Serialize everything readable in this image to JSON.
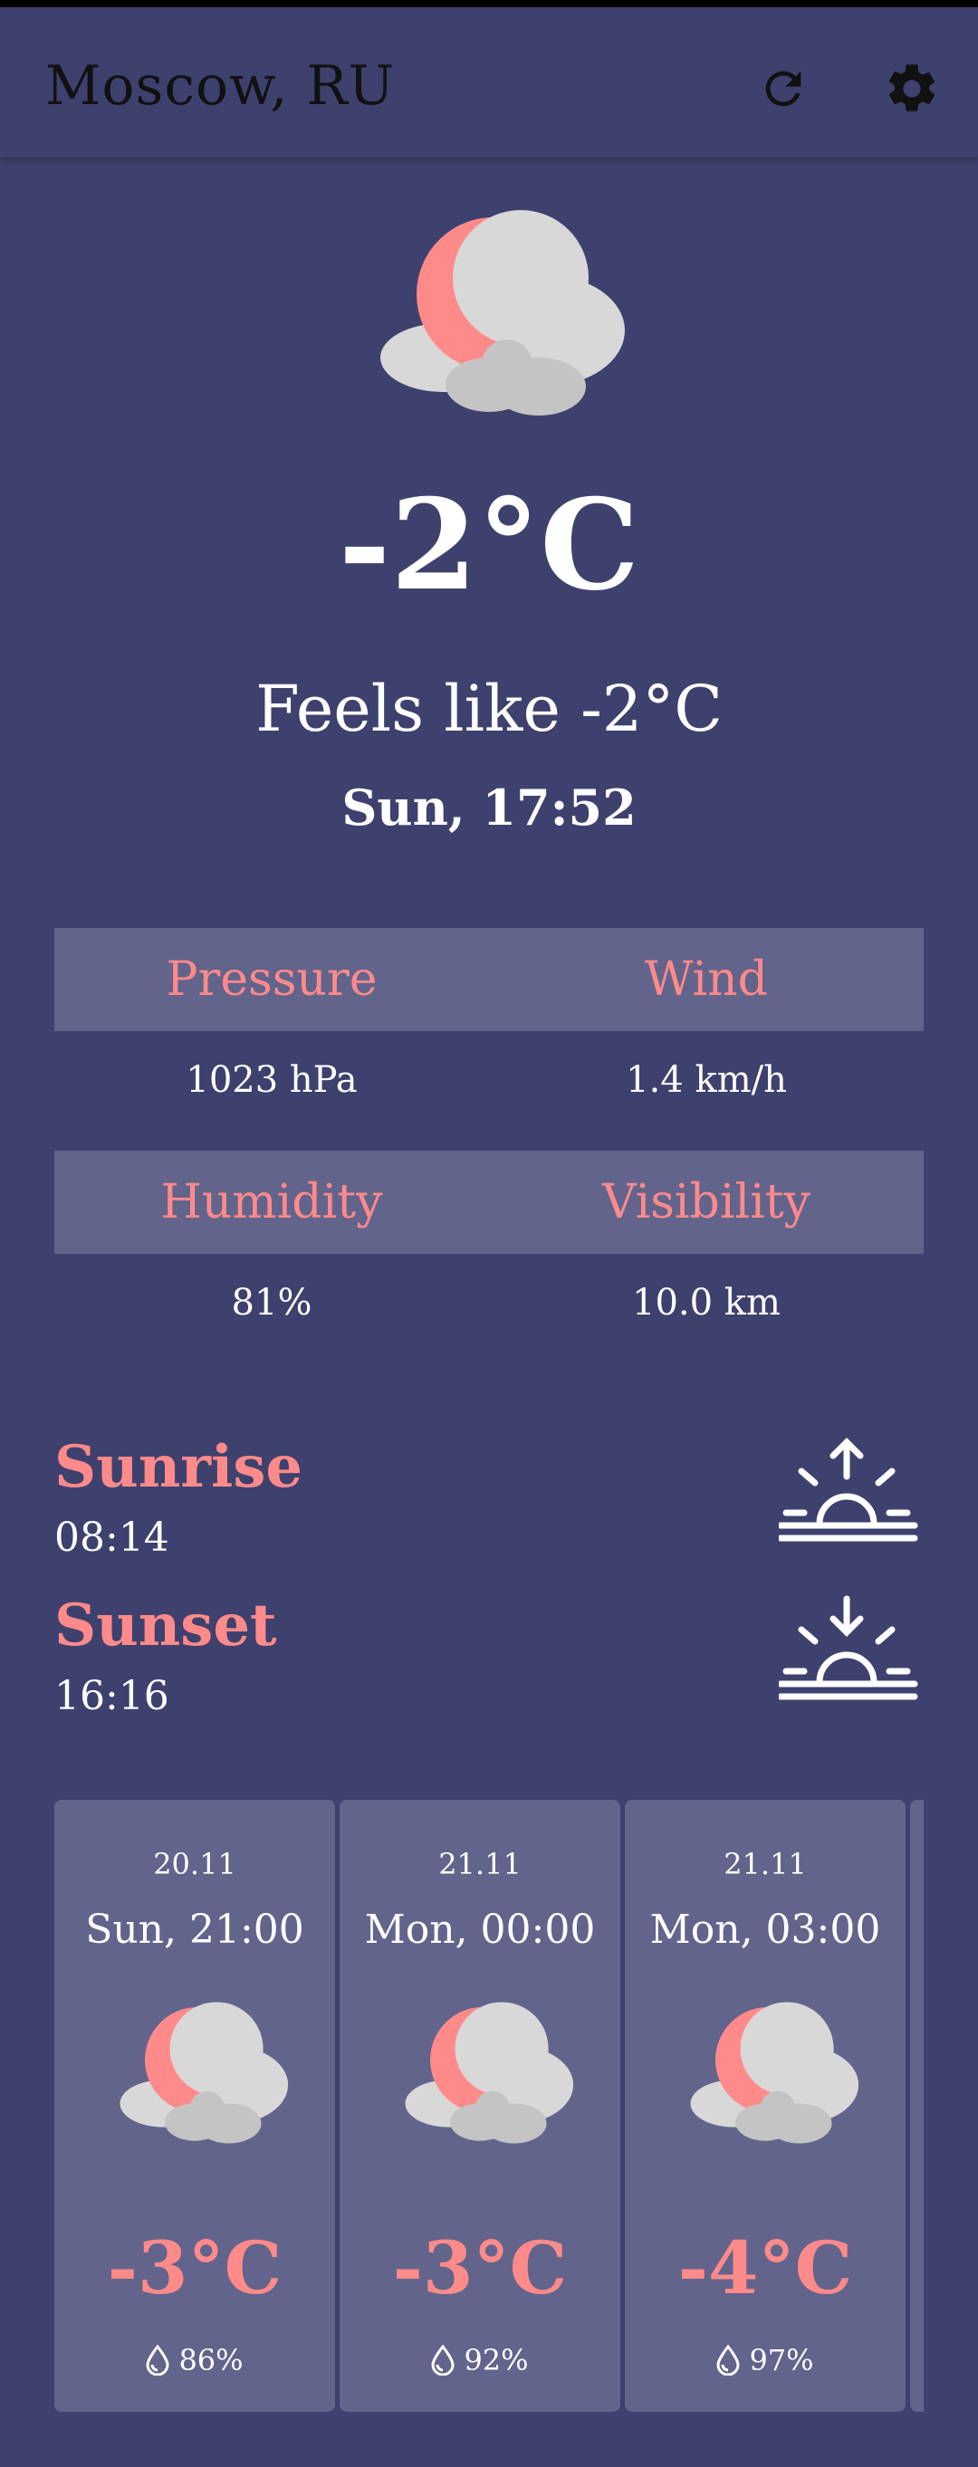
{
  "header": {
    "city": "Moscow, RU",
    "refresh_icon": "refresh-icon",
    "settings_icon": "gear-icon"
  },
  "current": {
    "icon": "night-partly-cloudy-icon",
    "temperature": "-2°C",
    "feels_like": "Feels like -2°C",
    "datetime": "Sun, 17:52"
  },
  "metrics": {
    "row1": {
      "left_label": "Pressure",
      "left_value": "1023 hPa",
      "right_label": "Wind",
      "right_value": "1.4 km/h"
    },
    "row2": {
      "left_label": "Humidity",
      "left_value": "81%",
      "right_label": "Visibility",
      "right_value": "10.0 km"
    }
  },
  "sun": {
    "sunrise_label": "Sunrise",
    "sunrise_time": "08:14",
    "sunrise_icon": "sunrise-icon",
    "sunset_label": "Sunset",
    "sunset_time": "16:16",
    "sunset_icon": "sunset-icon"
  },
  "forecast": [
    {
      "date": "20.11",
      "time": "Sun, 21:00",
      "temp": "-3°C",
      "humidity": "86%",
      "icon": "night-partly-cloudy-icon"
    },
    {
      "date": "21.11",
      "time": "Mon, 00:00",
      "temp": "-3°C",
      "humidity": "92%",
      "icon": "night-partly-cloudy-icon"
    },
    {
      "date": "21.11",
      "time": "Mon, 03:00",
      "temp": "-4°C",
      "humidity": "97%",
      "icon": "night-partly-cloudy-icon"
    }
  ],
  "colors": {
    "background": "#3e416e",
    "panel": "#62648c",
    "accent": "#ff8a8a",
    "text": "#ffffff"
  }
}
